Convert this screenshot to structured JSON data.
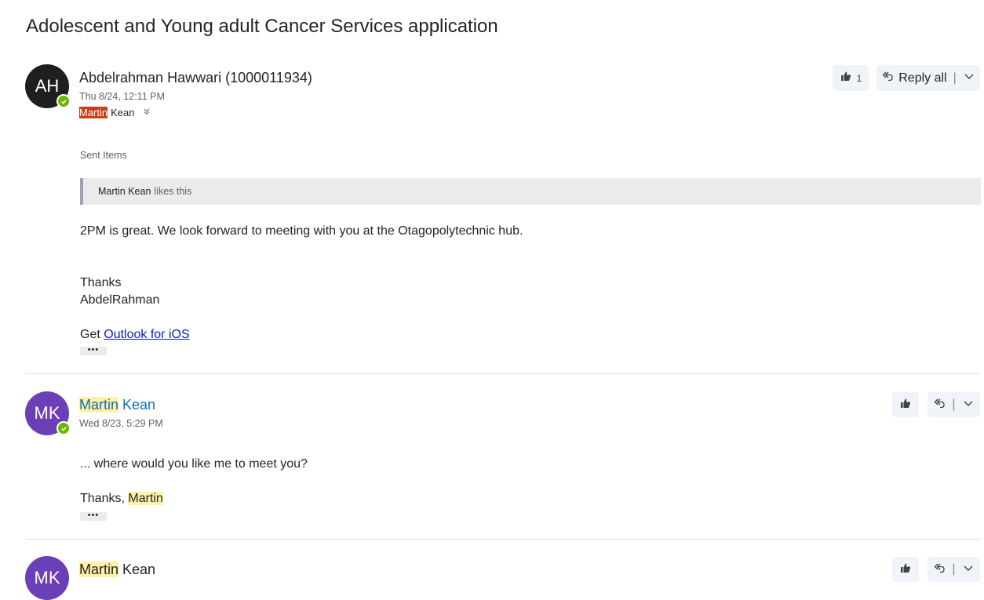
{
  "thread": {
    "subject": "Adolescent and Young adult Cancer Services application"
  },
  "messages": [
    {
      "avatar_initials": "AH",
      "sender": "Abdelrahman Hawwari (1000011934)",
      "date": "Thu 8/24, 12:11 PM",
      "recipient_first": "Martin",
      "recipient_last": "Kean",
      "folder": "Sent Items",
      "likes_name": "Martin Kean",
      "likes_suffix": "likes this",
      "like_count": "1",
      "reply_all_label": "Reply all",
      "body_line1": "2PM is great. We look forward to meeting with you at the Otagopolytechnic hub.",
      "thanks": "Thanks",
      "signature": "AbdelRahman",
      "get_label": "Get",
      "outlook_link": "Outlook for iOS",
      "more_label": "•••"
    },
    {
      "avatar_initials": "MK",
      "sender_first": "Martin",
      "sender_last": "Kean",
      "date": "Wed 8/23, 5:29 PM",
      "body_line1": "... where would you like me to meet you?",
      "thanks_prefix": "Thanks,",
      "thanks_name": "Martin",
      "more_label": "•••"
    },
    {
      "avatar_initials": "MK",
      "sender_first": "Martin",
      "sender_last": "Kean"
    }
  ],
  "icons": {
    "like": "thumbs-up-icon",
    "reply": "reply-all-icon",
    "chevron": "chevron-down-icon",
    "presence": "available-check-icon"
  },
  "colors": {
    "presence_green": "#6bb700",
    "avatar_ah": "#1f1f1f",
    "avatar_mk": "#6b3fb8",
    "highlight_yellow": "#fff1a6",
    "highlight_orange": "#c6401a",
    "link_blue": "#0f6cbd"
  }
}
